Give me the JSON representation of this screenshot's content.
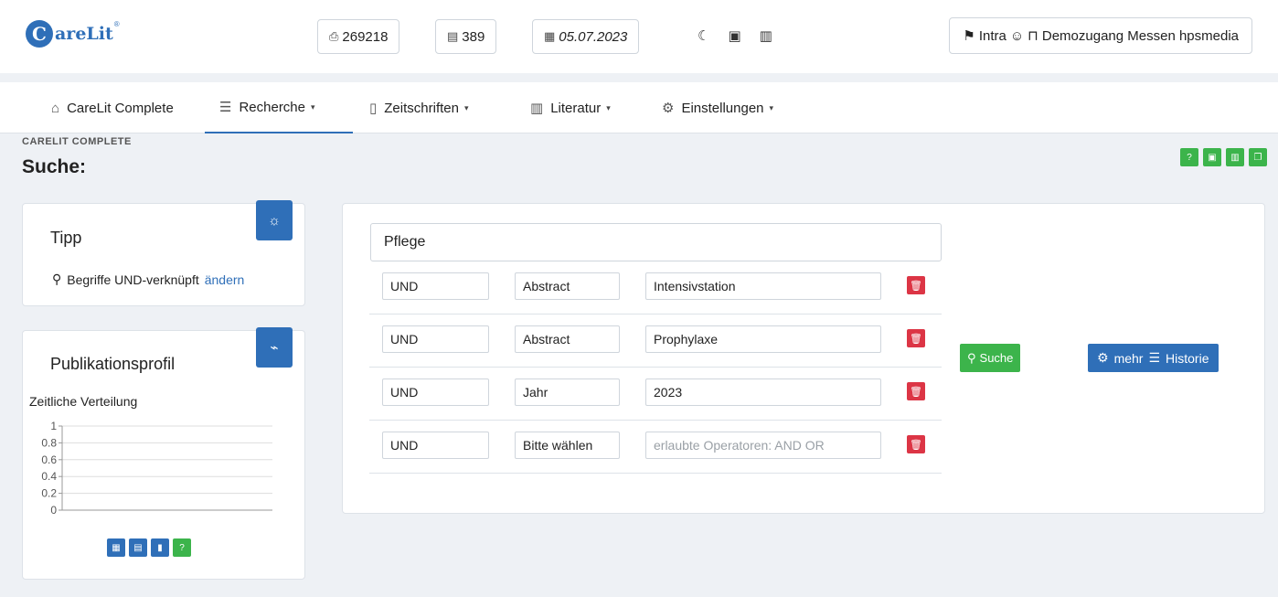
{
  "app": {
    "logo_text": "areLit",
    "logo_letter": "C",
    "logo_reg": "®"
  },
  "header": {
    "stat1": "269218",
    "stat2": "389",
    "date": "05.07.2023",
    "user_prefix": "Intra",
    "user_name": "Demozugang Messen hpsmedia"
  },
  "nav": {
    "items": [
      {
        "label": "CareLit Complete"
      },
      {
        "label": "Recherche"
      },
      {
        "label": "Zeitschriften"
      },
      {
        "label": "Literatur"
      },
      {
        "label": "Einstellungen"
      }
    ]
  },
  "page": {
    "breadcrumb": "CARELIT COMPLETE",
    "title": "Suche:"
  },
  "tipp": {
    "title": "Tipp",
    "text": "Begriffe UND-verknüpft",
    "link": "ändern"
  },
  "profil": {
    "title": "Publikationsprofil",
    "chart_label": "Zeitliche Verteilung"
  },
  "chart_data": {
    "type": "bar",
    "title": "Zeitliche Verteilung",
    "categories": [],
    "values": [],
    "ylim": [
      0,
      1
    ],
    "yticks": [
      "1",
      "0.8",
      "0.6",
      "0.4",
      "0.2",
      "0"
    ],
    "grid": true
  },
  "search": {
    "main_value": "Pflege",
    "rows": [
      {
        "op": "UND",
        "field": "Abstract",
        "value": "Intensivstation",
        "placeholder": ""
      },
      {
        "op": "UND",
        "field": "Abstract",
        "value": "Prophylaxe",
        "placeholder": ""
      },
      {
        "op": "UND",
        "field": "Jahr",
        "value": "2023",
        "placeholder": ""
      },
      {
        "op": "UND",
        "field": "Bitte wählen",
        "value": "",
        "placeholder": "erlaubte Operatoren: AND OR"
      }
    ],
    "search_button": "Suche",
    "mehr_button": "mehr",
    "historie_button": "Historie"
  },
  "colors": {
    "primary": "#2f6fb8",
    "success": "#3cb44b",
    "danger": "#dc3545"
  }
}
